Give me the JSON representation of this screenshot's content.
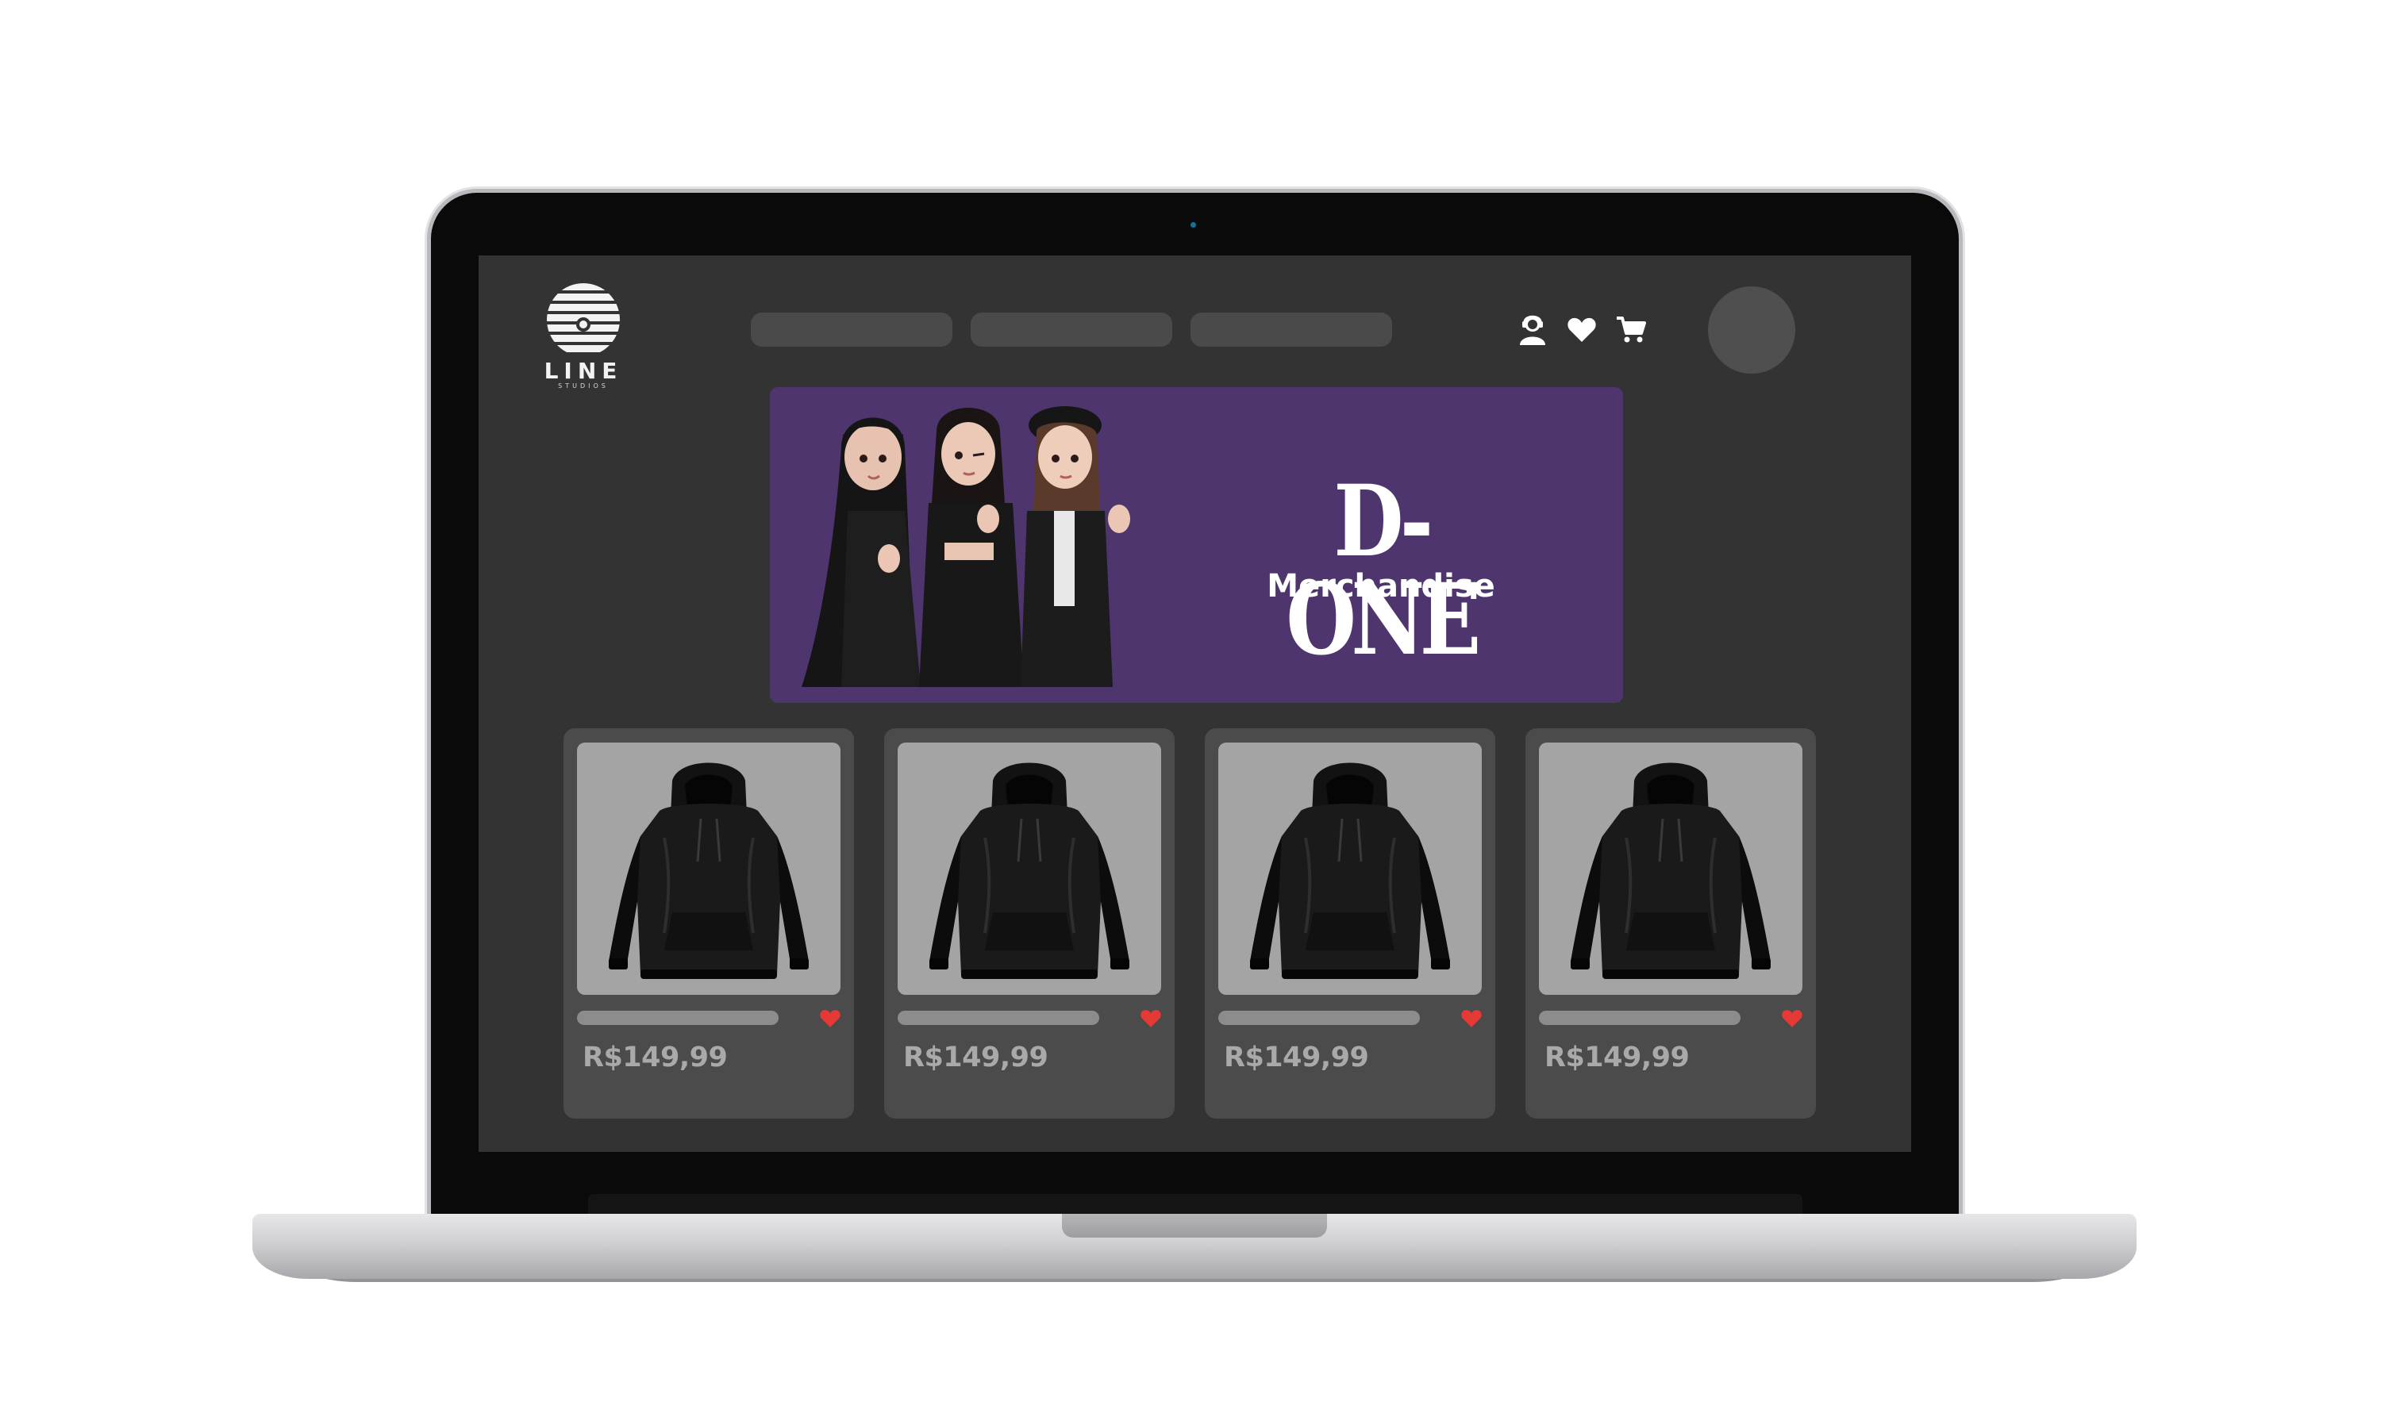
{
  "brand": {
    "name": "LINE",
    "subtitle": "STUDIOS"
  },
  "header": {
    "nav_items": [
      "",
      "",
      ""
    ],
    "icons": [
      "user-icon",
      "heart-icon",
      "cart-icon"
    ]
  },
  "banner": {
    "title": "D-ONE",
    "subtitle": "Merchandise",
    "background_color": "#4f356d"
  },
  "products": [
    {
      "name": "",
      "price": "R$149,99",
      "image": "black-hoodie"
    },
    {
      "name": "",
      "price": "R$149,99",
      "image": "black-hoodie"
    },
    {
      "name": "",
      "price": "R$149,99",
      "image": "black-hoodie"
    },
    {
      "name": "",
      "price": "R$149,99",
      "image": "black-hoodie"
    }
  ],
  "colors": {
    "screen_bg": "#333333",
    "card_bg": "#4b4b4b",
    "favorite": "#e53935"
  }
}
